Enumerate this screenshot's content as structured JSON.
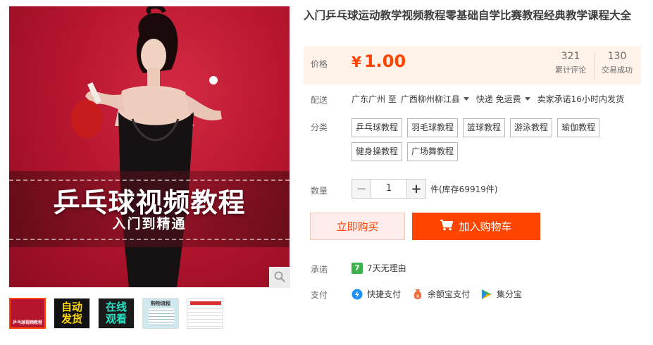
{
  "gallery": {
    "main_title": "乒乓球视频教程",
    "main_subtitle": "入门到精通",
    "zoom_icon": "search-icon",
    "thumbs": [
      {
        "text": "乒乓球视频教程"
      },
      {
        "text": "自动发货"
      },
      {
        "text": "在线观看"
      },
      {
        "text": "购物流程"
      },
      {
        "text": ""
      }
    ]
  },
  "product": {
    "title": "入门乒乓球运动教学视频教程零基础自学比赛教程经典教学课程大全"
  },
  "price": {
    "label": "价格",
    "currency": "¥",
    "amount": "1.00",
    "reviews_count": "321",
    "reviews_label": "累计评论",
    "sales_count": "130",
    "sales_label": "交易成功"
  },
  "delivery": {
    "label": "配送",
    "from": "广东广州 至",
    "to": "广西柳州柳江县",
    "method": "快递 免运费",
    "promise": "卖家承诺16小时内发货"
  },
  "category": {
    "label": "分类",
    "options": [
      "乒乓球教程",
      "羽毛球教程",
      "篮球教程",
      "游泳教程",
      "瑜伽教程",
      "健身操教程",
      "广场舞教程"
    ]
  },
  "quantity": {
    "label": "数量",
    "value": "1",
    "minus": "−",
    "plus": "+",
    "stock": "件(库存69919件)"
  },
  "actions": {
    "buy_now": "立即购买",
    "add_to_cart": "加入购物车"
  },
  "guarantee": {
    "label": "承诺",
    "badge": "7",
    "text": "7天无理由"
  },
  "payment": {
    "label": "支付",
    "methods": [
      {
        "name": "快捷支付",
        "icon": "quickpay-icon"
      },
      {
        "name": "余额宝支付",
        "icon": "yuebao-icon"
      },
      {
        "name": "集分宝",
        "icon": "jifenbao-icon"
      }
    ]
  },
  "colors": {
    "accent": "#ff4400",
    "price_bg": "#fff2e8",
    "promise_green": "#3bb34a"
  }
}
